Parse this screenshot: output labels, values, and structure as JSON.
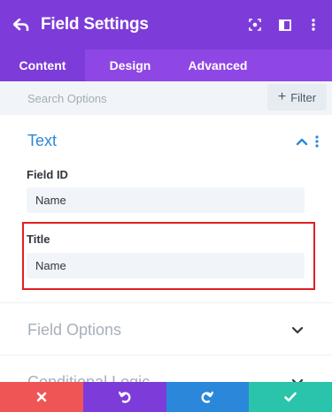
{
  "header": {
    "title": "Field Settings",
    "bg_color": "#7d3bd9"
  },
  "tabs": [
    {
      "label": "Content",
      "active": true
    },
    {
      "label": "Design",
      "active": false
    },
    {
      "label": "Advanced",
      "active": false
    }
  ],
  "search": {
    "placeholder": "Search Options",
    "filter_label": "Filter"
  },
  "sections": {
    "text": {
      "title": "Text",
      "expanded": true,
      "fields": [
        {
          "label": "Field ID",
          "value": "Name"
        },
        {
          "label": "Title",
          "value": "Name",
          "highlighted": true
        }
      ]
    },
    "field_options": {
      "title": "Field Options",
      "expanded": false
    },
    "conditional_logic": {
      "title": "Conditional Logic",
      "expanded": false
    }
  },
  "footer": {
    "buttons": [
      {
        "name": "discard",
        "icon": "close-icon",
        "color": "#ef5555"
      },
      {
        "name": "undo",
        "icon": "undo-icon",
        "color": "#7d3bd9"
      },
      {
        "name": "redo",
        "icon": "redo-icon",
        "color": "#2b87da"
      },
      {
        "name": "save",
        "icon": "check-icon",
        "color": "#29c4a9"
      }
    ]
  },
  "colors": {
    "accent_blue": "#2b87da",
    "highlight_red": "#e02020",
    "tabs_bg": "#8e47e4"
  }
}
